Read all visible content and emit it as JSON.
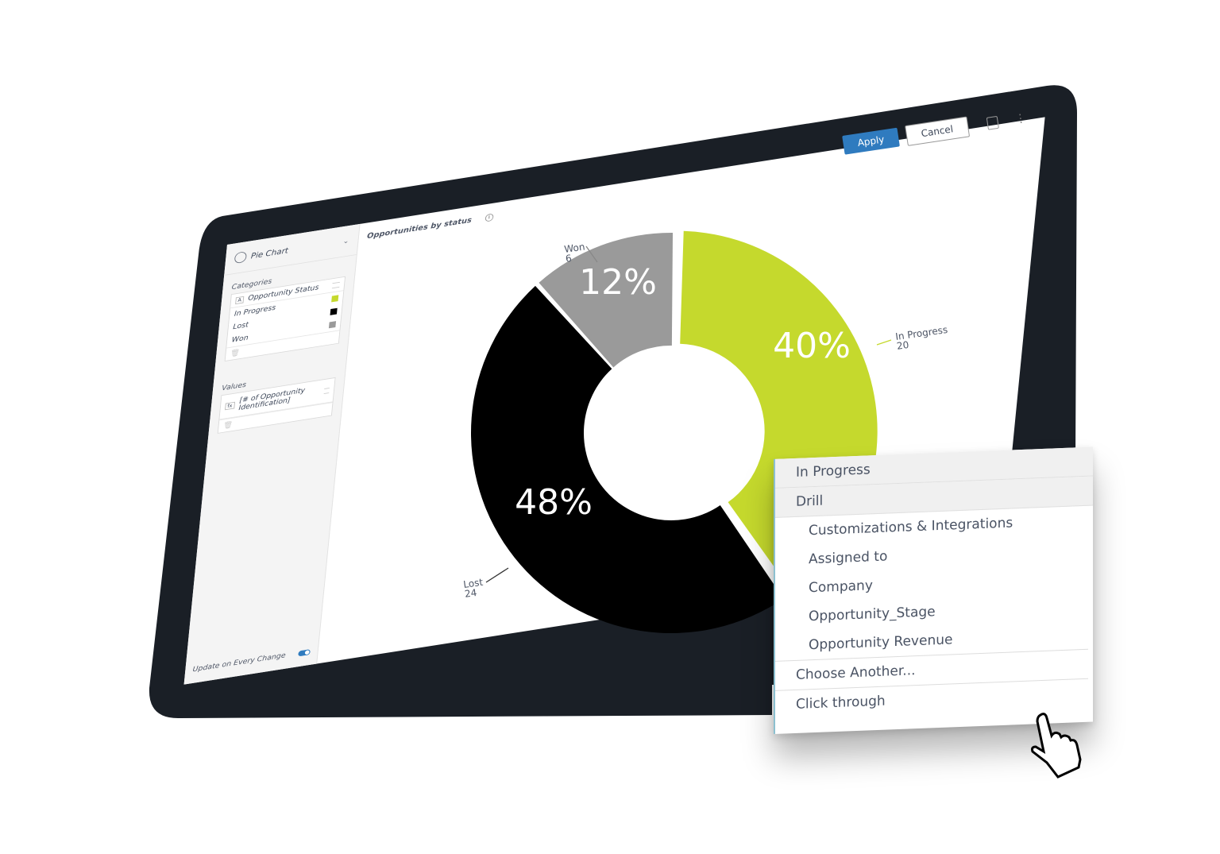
{
  "toolbar": {
    "apply_label": "Apply",
    "cancel_label": "Cancel"
  },
  "sidebar": {
    "chart_type": "Pie Chart",
    "categories_label": "Categories",
    "category_field": "Opportunity Status",
    "category_items": [
      {
        "label": "In Progress",
        "color": "#c5d92d"
      },
      {
        "label": "Lost",
        "color": "#000000"
      },
      {
        "label": "Won",
        "color": "#9a9a9a"
      }
    ],
    "values_label": "Values",
    "value_field": "[# of Opportunity Identification]",
    "update_label": "Update on Every Change",
    "update_enabled": true
  },
  "chart_title": "Opportunities by status",
  "chart_data": {
    "type": "pie",
    "donut": true,
    "title": "Opportunities by status",
    "categories": [
      "In Progress",
      "Lost",
      "Won"
    ],
    "values": [
      20,
      24,
      6
    ],
    "percent_labels": [
      "40%",
      "48%",
      "12%"
    ],
    "colors": [
      "#c5d92d",
      "#000000",
      "#9a9a9a"
    ],
    "exploded": "In Progress"
  },
  "context_menu": {
    "header": "In Progress",
    "drill_label": "Drill",
    "drill_items": [
      "Customizations & Integrations",
      "Assigned to",
      "Company",
      "Opportunity_Stage",
      "Opportunity Revenue"
    ],
    "choose_another": "Choose Another...",
    "click_through": "Click through"
  }
}
